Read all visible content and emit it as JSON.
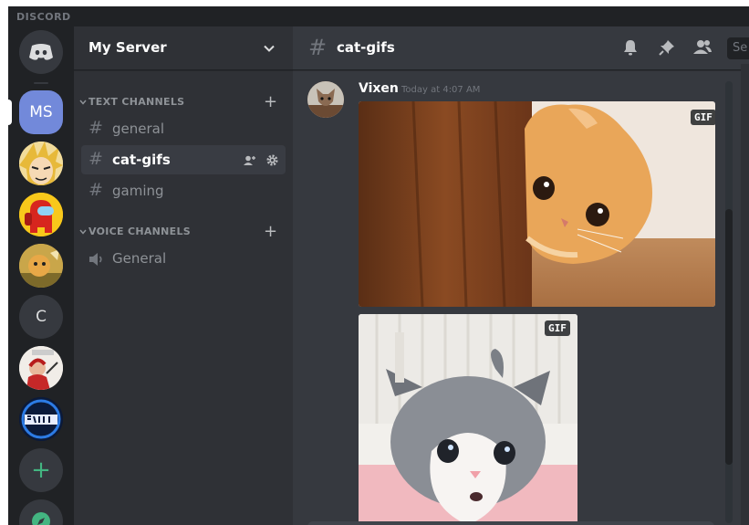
{
  "titlebar": {
    "brand": "DISCORD"
  },
  "servers": {
    "selected_initials": "MS",
    "c_initial": "C",
    "add_glyph": "+"
  },
  "sidebar": {
    "server_name": "My Server",
    "text_category": "TEXT CHANNELS",
    "voice_category": "VOICE CHANNELS",
    "text_channels": [
      {
        "name": "general"
      },
      {
        "name": "cat-gifs"
      },
      {
        "name": "gaming"
      }
    ],
    "voice_channels": [
      {
        "name": "General"
      }
    ],
    "hash_glyph": "#",
    "plus_glyph": "+"
  },
  "chat": {
    "channel_name": "cat-gifs",
    "search_placeholder": "Se",
    "message": {
      "author": "Vixen",
      "timestamp": "Today at 4:07 AM",
      "attachments": [
        {
          "badge": "GIF"
        },
        {
          "badge": "GIF"
        }
      ]
    }
  },
  "icons": {
    "home": "discord-logo-icon",
    "chevron": "chevron-down-icon",
    "bell": "bell-icon",
    "pin": "pin-icon",
    "members": "members-icon",
    "speaker": "speaker-icon",
    "invite": "add-member-icon",
    "settings": "gear-icon",
    "explore": "compass-icon"
  },
  "colors": {
    "blurple": "#7289da",
    "green": "#43b581",
    "bg_main": "#36393f",
    "bg_sidebar": "#2f3136",
    "bg_rail": "#202225"
  }
}
